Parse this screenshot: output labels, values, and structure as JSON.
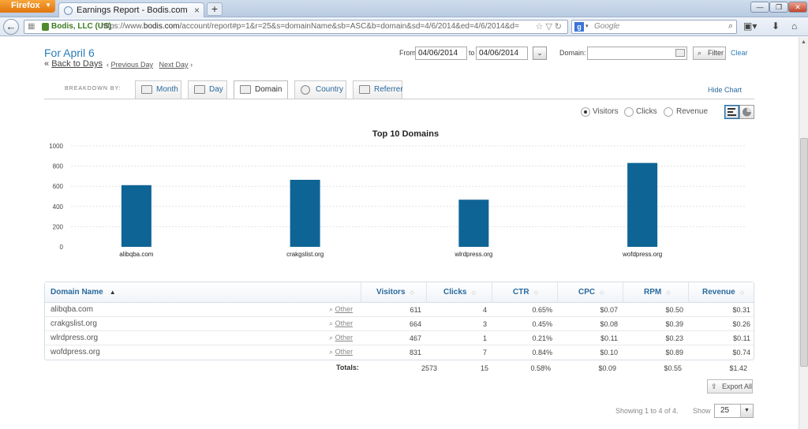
{
  "browser": {
    "app_button": "Firefox",
    "tab_title": "Earnings Report - Bodis.com",
    "site_identity": "Bodis, LLC (US)",
    "url_prefix": "https://www.",
    "url_host": "bodis.com",
    "url_path": "/account/report#p=1&r=25&s=domainName&sb=ASC&b=domain&sd=4/6/2014&ed=4/6/2014&d=",
    "search_placeholder": "Google"
  },
  "header": {
    "title": "For April 6",
    "back_to_days": "Back to Days",
    "previous_day": "Previous Day",
    "next_day": "Next Day"
  },
  "filters": {
    "from_label": "From",
    "from_date": "04/06/2014",
    "to_label": "to",
    "to_date": "04/06/2014",
    "domain_label": "Domain:",
    "domain_value": "",
    "filter_button": "Filter",
    "clear_link": "Clear"
  },
  "breakdown": {
    "label": "BREAKDOWN BY:",
    "tabs": [
      "Month",
      "Day",
      "Domain",
      "Country",
      "Referrer"
    ],
    "active": "Domain",
    "hide_chart": "Hide Chart"
  },
  "metric_toggle": {
    "options": [
      "Visitors",
      "Clicks",
      "Revenue"
    ],
    "selected": "Visitors"
  },
  "chart_data": {
    "type": "bar",
    "title": "Top 10 Domains",
    "categories": [
      "alibqba.com",
      "crakgslist.org",
      "wlrdpress.org",
      "wofdpress.org"
    ],
    "values": [
      611,
      664,
      467,
      831
    ],
    "ylim": [
      0,
      1000
    ],
    "yticks": [
      0,
      200,
      400,
      600,
      800,
      1000
    ],
    "xlabel": "",
    "ylabel": "",
    "grid": true,
    "bar_color": "#0f6496"
  },
  "table": {
    "columns": [
      "Domain Name",
      "Visitors",
      "Clicks",
      "CTR",
      "CPC",
      "RPM",
      "Revenue"
    ],
    "other_label": "Other",
    "rows": [
      {
        "domain": "alibqba.com",
        "visitors": "611",
        "clicks": "4",
        "ctr": "0.65%",
        "cpc": "$0.07",
        "rpm": "$0.50",
        "revenue": "$0.31"
      },
      {
        "domain": "crakgslist.org",
        "visitors": "664",
        "clicks": "3",
        "ctr": "0.45%",
        "cpc": "$0.08",
        "rpm": "$0.39",
        "revenue": "$0.26"
      },
      {
        "domain": "wlrdpress.org",
        "visitors": "467",
        "clicks": "1",
        "ctr": "0.21%",
        "cpc": "$0.11",
        "rpm": "$0.23",
        "revenue": "$0.11"
      },
      {
        "domain": "wofdpress.org",
        "visitors": "831",
        "clicks": "7",
        "ctr": "0.84%",
        "cpc": "$0.10",
        "rpm": "$0.89",
        "revenue": "$0.74"
      }
    ],
    "totals_label": "Totals:",
    "totals": {
      "visitors": "2573",
      "clicks": "15",
      "ctr": "0.58%",
      "cpc": "$0.09",
      "rpm": "$0.55",
      "revenue": "$1.42"
    }
  },
  "footer": {
    "export_button": "Export All",
    "showing_text": "Showing 1 to 4 of 4.",
    "show_label": "Show",
    "page_size": "25"
  }
}
